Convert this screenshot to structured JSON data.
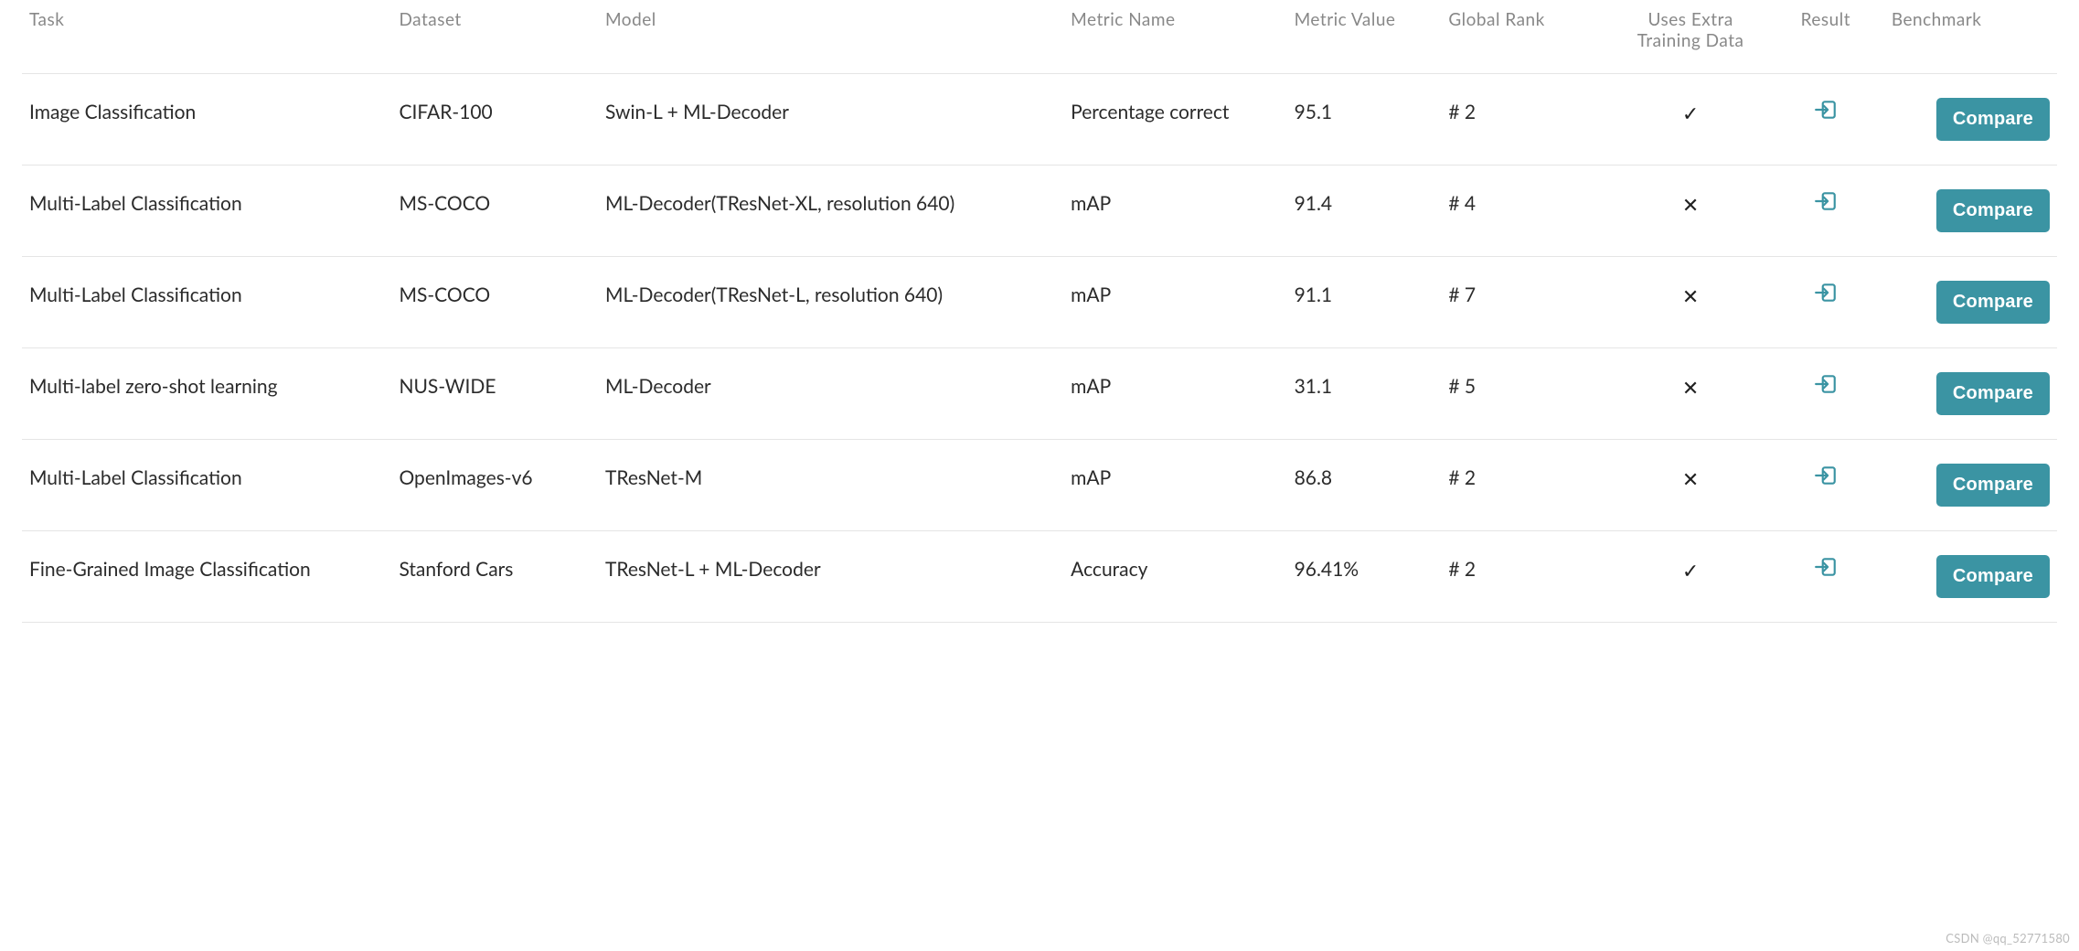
{
  "headers": {
    "task": "Task",
    "dataset": "Dataset",
    "model": "Model",
    "metric_name": "Metric Name",
    "metric_value": "Metric Value",
    "global_rank": "Global Rank",
    "extra_data": "Uses Extra Training Data",
    "result": "Result",
    "benchmark": "Benchmark"
  },
  "compare_label": "Compare",
  "watermark": "CSDN @qq_52771580",
  "rows": [
    {
      "task": "Image Classification",
      "dataset": "CIFAR-100",
      "model": "Swin-L + ML-Decoder",
      "metric_name": "Percentage correct",
      "metric_value": "95.1",
      "global_rank": "# 2",
      "extra_data": "✓"
    },
    {
      "task": "Multi-Label Classification",
      "dataset": "MS-COCO",
      "model": "ML-Decoder(TResNet-XL, resolution 640)",
      "metric_name": "mAP",
      "metric_value": "91.4",
      "global_rank": "# 4",
      "extra_data": "✕"
    },
    {
      "task": "Multi-Label Classification",
      "dataset": "MS-COCO",
      "model": "ML-Decoder(TResNet-L, resolution 640)",
      "metric_name": "mAP",
      "metric_value": "91.1",
      "global_rank": "# 7",
      "extra_data": "✕"
    },
    {
      "task": "Multi-label zero-shot learning",
      "dataset": "NUS-WIDE",
      "model": "ML-Decoder",
      "metric_name": "mAP",
      "metric_value": "31.1",
      "global_rank": "# 5",
      "extra_data": "✕"
    },
    {
      "task": "Multi-Label Classification",
      "dataset": "OpenImages-v6",
      "model": "TResNet-M",
      "metric_name": "mAP",
      "metric_value": "86.8",
      "global_rank": "# 2",
      "extra_data": "✕"
    },
    {
      "task": "Fine-Grained Image Classification",
      "dataset": "Stanford Cars",
      "model": "TResNet-L + ML-Decoder",
      "metric_name": "Accuracy",
      "metric_value": "96.41%",
      "global_rank": "# 2",
      "extra_data": "✓"
    }
  ]
}
